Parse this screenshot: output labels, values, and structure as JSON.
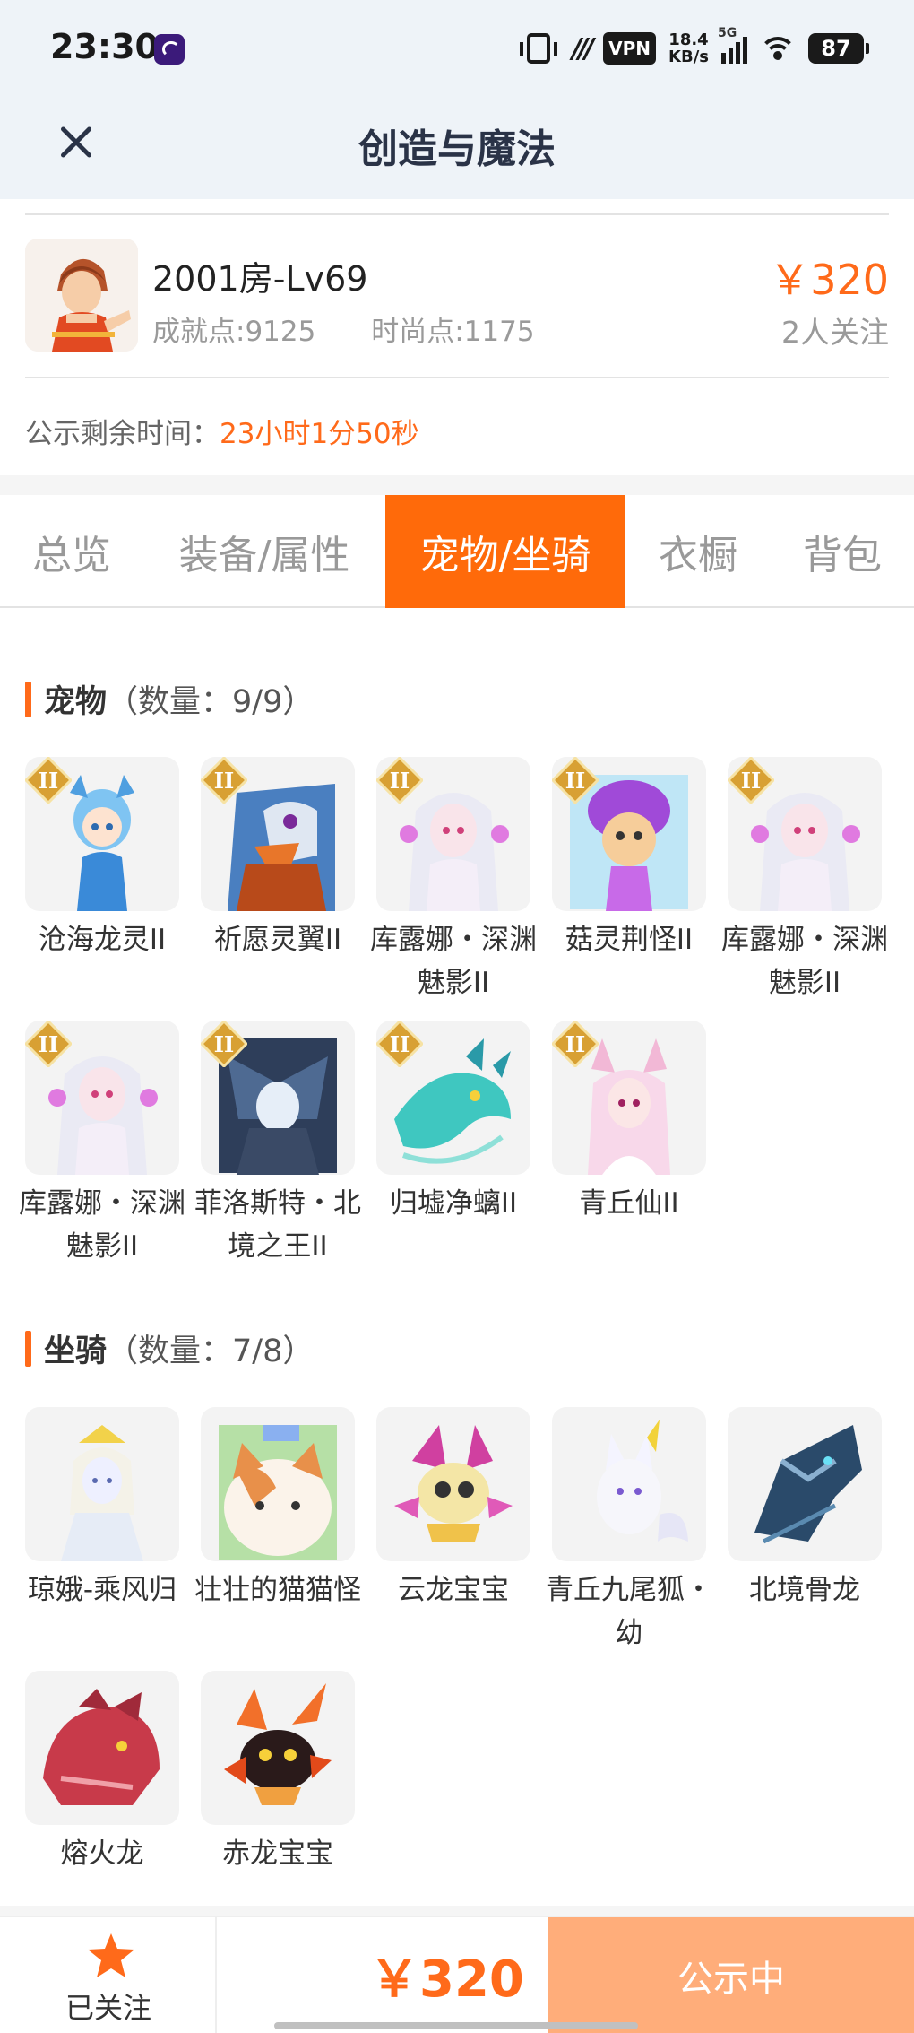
{
  "status_bar": {
    "time": "23:30",
    "vpn": "VPN",
    "net_speed_value": "18.4",
    "net_speed_unit": "KB/s",
    "network": "5G",
    "battery": "87"
  },
  "nav": {
    "title": "创造与魔法"
  },
  "listing": {
    "seller_name": "2001房-Lv69",
    "achievement": "成就点:9125",
    "fashion": "时尚点:1175",
    "price": "￥320",
    "followers": "2人关注",
    "countdown_label": "公示剩余时间：",
    "countdown_value": "23小时1分50秒"
  },
  "tabs": [
    "总览",
    "装备/属性",
    "宠物/坐骑",
    "衣橱",
    "背包"
  ],
  "active_tab_index": 2,
  "pets": {
    "title": "宠物",
    "count": "（数量：9/9）",
    "items": [
      {
        "name": "沧海龙灵II",
        "icon": "blue-dragon-spirit-icon"
      },
      {
        "name": "祈愿灵翼II",
        "icon": "griffin-icon"
      },
      {
        "name": "库露娜・深渊魅影II",
        "icon": "white-hair-girl-icon"
      },
      {
        "name": "菇灵荆怪II",
        "icon": "purple-mushroom-icon"
      },
      {
        "name": "库露娜・深渊魅影II",
        "icon": "white-hair-girl-icon"
      },
      {
        "name": "库露娜・深渊魅影II",
        "icon": "white-hair-girl-icon"
      },
      {
        "name": "菲洛斯特・北境之王II",
        "icon": "frost-king-icon"
      },
      {
        "name": "归墟净螭II",
        "icon": "teal-dragon-icon"
      },
      {
        "name": "青丘仙II",
        "icon": "fox-fairy-icon"
      }
    ],
    "badge": "II"
  },
  "mounts": {
    "title": "坐骑",
    "count": "（数量：7/8）",
    "items": [
      {
        "name": "琼娥-乘风归",
        "icon": "moon-lady-icon"
      },
      {
        "name": "壮壮的猫猫怪",
        "icon": "fat-cat-icon"
      },
      {
        "name": "云龙宝宝",
        "icon": "cloud-dragon-baby-icon"
      },
      {
        "name": "青丘九尾狐・幼",
        "icon": "nine-tail-fox-icon"
      },
      {
        "name": "北境骨龙",
        "icon": "bone-dragon-icon"
      },
      {
        "name": "熔火龙",
        "icon": "red-dragon-icon"
      },
      {
        "name": "赤龙宝宝",
        "icon": "fire-dragon-baby-icon"
      }
    ]
  },
  "bottom": {
    "follow_label": "已关注",
    "price": "￥320",
    "status_label": "公示中"
  },
  "colors": {
    "accent": "#ff6a1a",
    "tab_active": "#ff6a0a",
    "status_button": "#ffad7a",
    "header_bg": "#eef3f8"
  }
}
